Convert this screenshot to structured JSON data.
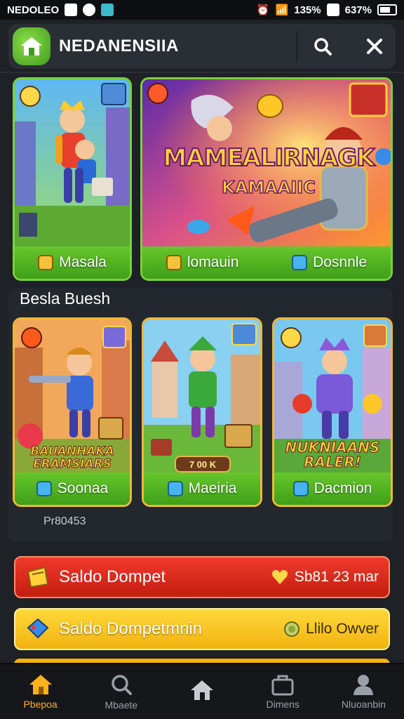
{
  "status_bar": {
    "left_text": "NEDOLEO",
    "battery_a": "135%",
    "battery_b": "637%"
  },
  "header": {
    "title": "NEDANENSIIA"
  },
  "top_cards": [
    {
      "label": "Masala"
    },
    {
      "banner_title": "MAMEALIRNAGK",
      "banner_subtitle": "KAMAAIIC",
      "left_label": "lomauin",
      "right_label": "Dosnnle"
    }
  ],
  "section": {
    "title": "Besla Buesh",
    "caption": "Pr80453",
    "cards": [
      {
        "overlay": "BAUANHAKA ERAMSIARS",
        "label": "Soonaa"
      },
      {
        "price": "7 00 K",
        "label": "Maeiria"
      },
      {
        "overlay": "NUKNIAANS RALER!",
        "label": "Dacmion"
      }
    ]
  },
  "actions": {
    "primary": {
      "label": "Saldo Dompet",
      "value": "Sb81 23 mar"
    },
    "secondary": {
      "label": "Saldo Dompetmnin",
      "value": "Llilo Owver"
    }
  },
  "bottom_nav": [
    {
      "label": "Pbepoa",
      "icon": "home-icon"
    },
    {
      "label": "Mbaete",
      "icon": "search-icon"
    },
    {
      "label": "",
      "icon": "home-outline-icon"
    },
    {
      "label": "Dimens",
      "icon": "bag-icon"
    },
    {
      "label": "Nluoanbin",
      "icon": "user-icon"
    }
  ],
  "colors": {
    "accent_green": "#5cbd24",
    "accent_red": "#d8261a",
    "accent_yellow": "#f5c21f",
    "nav_active": "#ffb21a"
  }
}
